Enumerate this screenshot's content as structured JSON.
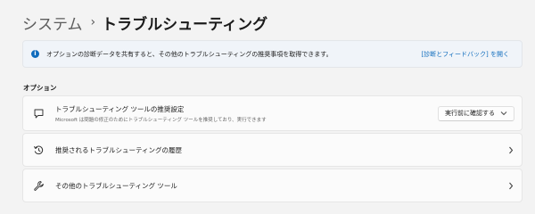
{
  "breadcrumb": {
    "parent": "システム",
    "separator": "›",
    "current": "トラブルシューティング"
  },
  "info_bar": {
    "icon": "info-icon",
    "text": "オプションの診断データを共有すると、その他のトラブルシューティングの推奨事項を取得できます。",
    "link": "[診断とフィードバック] を開く"
  },
  "section": {
    "heading": "オプション"
  },
  "rows": [
    {
      "icon": "chat-message-icon",
      "title": "トラブルシューティング ツールの推奨設定",
      "subtitle": "Microsoft は問題の修正のためにトラブルシューティング ツールを推奨しており、実行できます",
      "dropdown": {
        "value": "実行前に確認する",
        "icon": "chevron-down-icon"
      }
    },
    {
      "icon": "history-icon",
      "title": "推奨されるトラブルシューティングの履歴",
      "action_icon": "chevron-right-icon"
    },
    {
      "icon": "wrench-icon",
      "title": "その他のトラブルシューティング ツール",
      "action_icon": "chevron-right-icon"
    }
  ],
  "colors": {
    "background": "#f3f3f3",
    "card": "#fbfbfb",
    "info_bar": "#f0f4f9",
    "accent": "#0f6cbd"
  }
}
